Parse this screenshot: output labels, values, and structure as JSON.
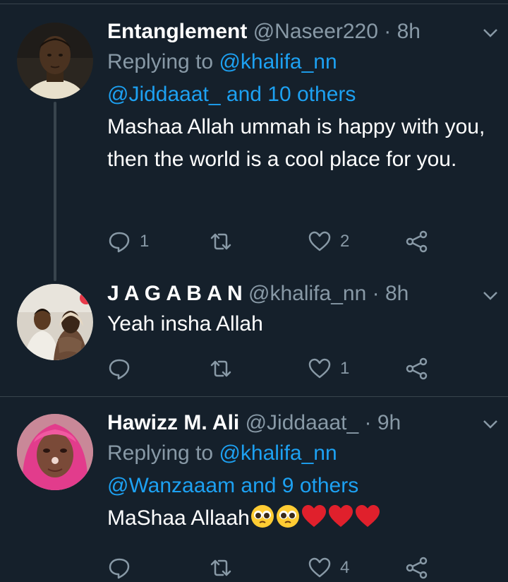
{
  "tweets": [
    {
      "name": "Entanglement",
      "handle": "@Naseer220",
      "dot": "·",
      "time": "8h",
      "replying_label": "Replying to",
      "replying_to_first": "@khalifa_nn",
      "replying_to_rest": "@Jiddaaat_ and 10 others",
      "text": "Mashaa Allah ummah is happy with you, then the world is a cool place for you.",
      "reply_count": "1",
      "retweet_count": "",
      "like_count": "2"
    },
    {
      "name": "J A G A B A N",
      "handle": "@khalifa_nn",
      "dot": "·",
      "time": "8h",
      "text": "Yeah insha Allah",
      "reply_count": "",
      "retweet_count": "",
      "like_count": "1"
    },
    {
      "name": "Hawizz M. Ali",
      "handle": "@Jiddaaat_",
      "dot": "·",
      "time": "9h",
      "replying_label": "Replying to",
      "replying_to_first": "@khalifa_nn",
      "replying_to_rest": "@Wanzaaam and 9 others",
      "text": "MaShaa Allaah",
      "emojis": [
        "pleading-face",
        "pleading-face",
        "red-heart",
        "red-heart",
        "red-heart"
      ],
      "reply_count": "",
      "retweet_count": "",
      "like_count": "4"
    }
  ],
  "colors": {
    "background": "#15202b",
    "text": "#ffffff",
    "secondary": "#8899a6",
    "link": "#1da1f2",
    "divider": "#38444d"
  }
}
